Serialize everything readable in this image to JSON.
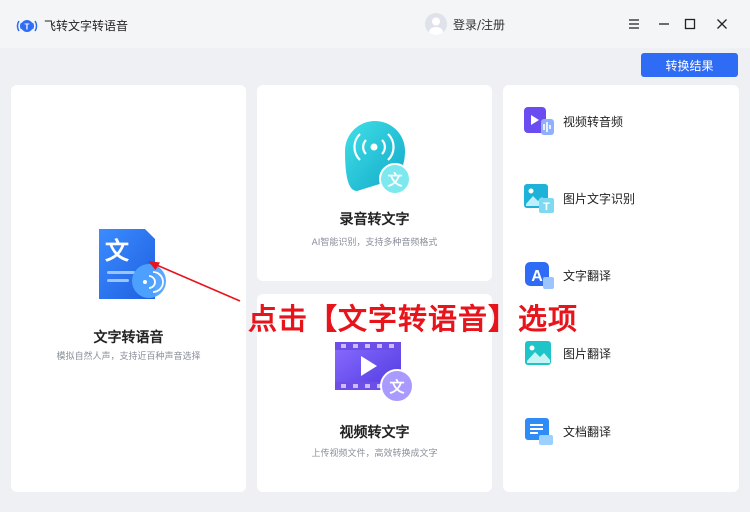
{
  "app": {
    "title": "飞转文字转语音"
  },
  "header": {
    "login_label": "登录/注册"
  },
  "toolbar": {
    "convert_result_label": "转换结果"
  },
  "cards": {
    "tts": {
      "title": "文字转语音",
      "subtitle": "模拟自然人声，支持近百种声音选择"
    },
    "recording": {
      "title": "录音转文字",
      "subtitle": "AI智能识别，支持多种音频格式"
    },
    "video": {
      "title": "视频转文字",
      "subtitle": "上传视频文件，高效转换成文字"
    }
  },
  "side_items": [
    {
      "label": "视频转音频",
      "icon": "video-audio-icon"
    },
    {
      "label": "图片文字识别",
      "icon": "image-ocr-icon"
    },
    {
      "label": "文字翻译",
      "icon": "text-translate-icon"
    },
    {
      "label": "图片翻译",
      "icon": "image-translate-icon"
    },
    {
      "label": "文档翻译",
      "icon": "document-translate-icon"
    }
  ],
  "annotation": {
    "text": "点击【文字转语音】选项"
  },
  "colors": {
    "accent": "#2f6cf6",
    "annotation": "#e8141c",
    "teal": "#1ec4d4"
  }
}
